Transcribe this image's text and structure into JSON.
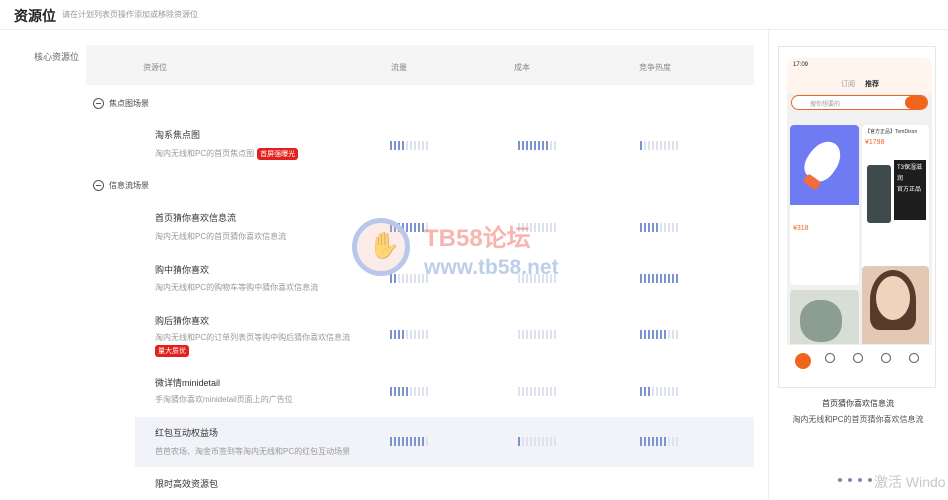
{
  "header": {
    "title": "资源位",
    "subtitle": "请在计划列表页操作添加或移除资源位"
  },
  "section_label": "核心资源位",
  "table": {
    "columns": [
      "资源位",
      "流量",
      "成本",
      "竞争热度"
    ]
  },
  "groups": [
    {
      "label": "焦点图场景",
      "rows": [
        {
          "title": "淘系焦点图",
          "desc": "淘内无线和PC的首页焦点图",
          "badge": "首屏强曝光",
          "traffic": 4,
          "cost": 8,
          "heat": 1
        }
      ]
    },
    {
      "label": "信息流场景",
      "rows": [
        {
          "title": "首页猜你喜欢信息流",
          "desc": "淘内无线和PC的首页猜你喜欢信息流",
          "badge": "",
          "traffic": 9,
          "cost": 0,
          "heat": 5
        },
        {
          "title": "购中猜你喜欢",
          "desc": "淘内无线和PC的购物车等购中猜你喜欢信息流",
          "badge": "",
          "traffic": 2,
          "cost": 0,
          "heat": 10
        },
        {
          "title": "购后猜你喜欢",
          "desc": "淘内无线和PC的订单列表页等购中购后猜你喜欢信息流",
          "badge": "量大质优",
          "traffic": 4,
          "cost": 0,
          "heat": 7
        },
        {
          "title": "微详情minidetail",
          "desc": "手淘猜你喜欢minidetail页面上的广告位",
          "badge": "",
          "traffic": 5,
          "cost": 0,
          "heat": 3
        },
        {
          "title": "红包互动权益场",
          "desc": "芭芭农场、淘金币签到等淘内无线和PC的红包互动场景",
          "badge": "",
          "traffic": 9,
          "cost": 1,
          "heat": 7
        },
        {
          "title": "限时高效资源包",
          "desc": "",
          "badge": "",
          "traffic": 0,
          "cost": 0,
          "heat": 0
        }
      ]
    }
  ],
  "preview": {
    "title": "首页猜你喜欢信息流",
    "desc": "淘内无线和PC的首页猜你喜欢信息流",
    "phone": {
      "time": "17:09",
      "tab_1": "订阅",
      "tab_2": "推荐",
      "search_placeholder": "搜你想要的",
      "left_price": "¥318",
      "right_head": "【官方正品】TomDixon",
      "right_price": "¥1798",
      "right_label_1": "T3保湿滋润",
      "right_label_2": "官方正品"
    }
  },
  "watermark": {
    "title": "TB58论坛",
    "url": "www.tb58.net"
  },
  "os_overlay": "激活 Windo",
  "colors": {
    "accent": "#e4201c",
    "meter_on": "#7b93cf",
    "meter_off": "#dde2ee",
    "phone_brand": "#f0641e"
  }
}
